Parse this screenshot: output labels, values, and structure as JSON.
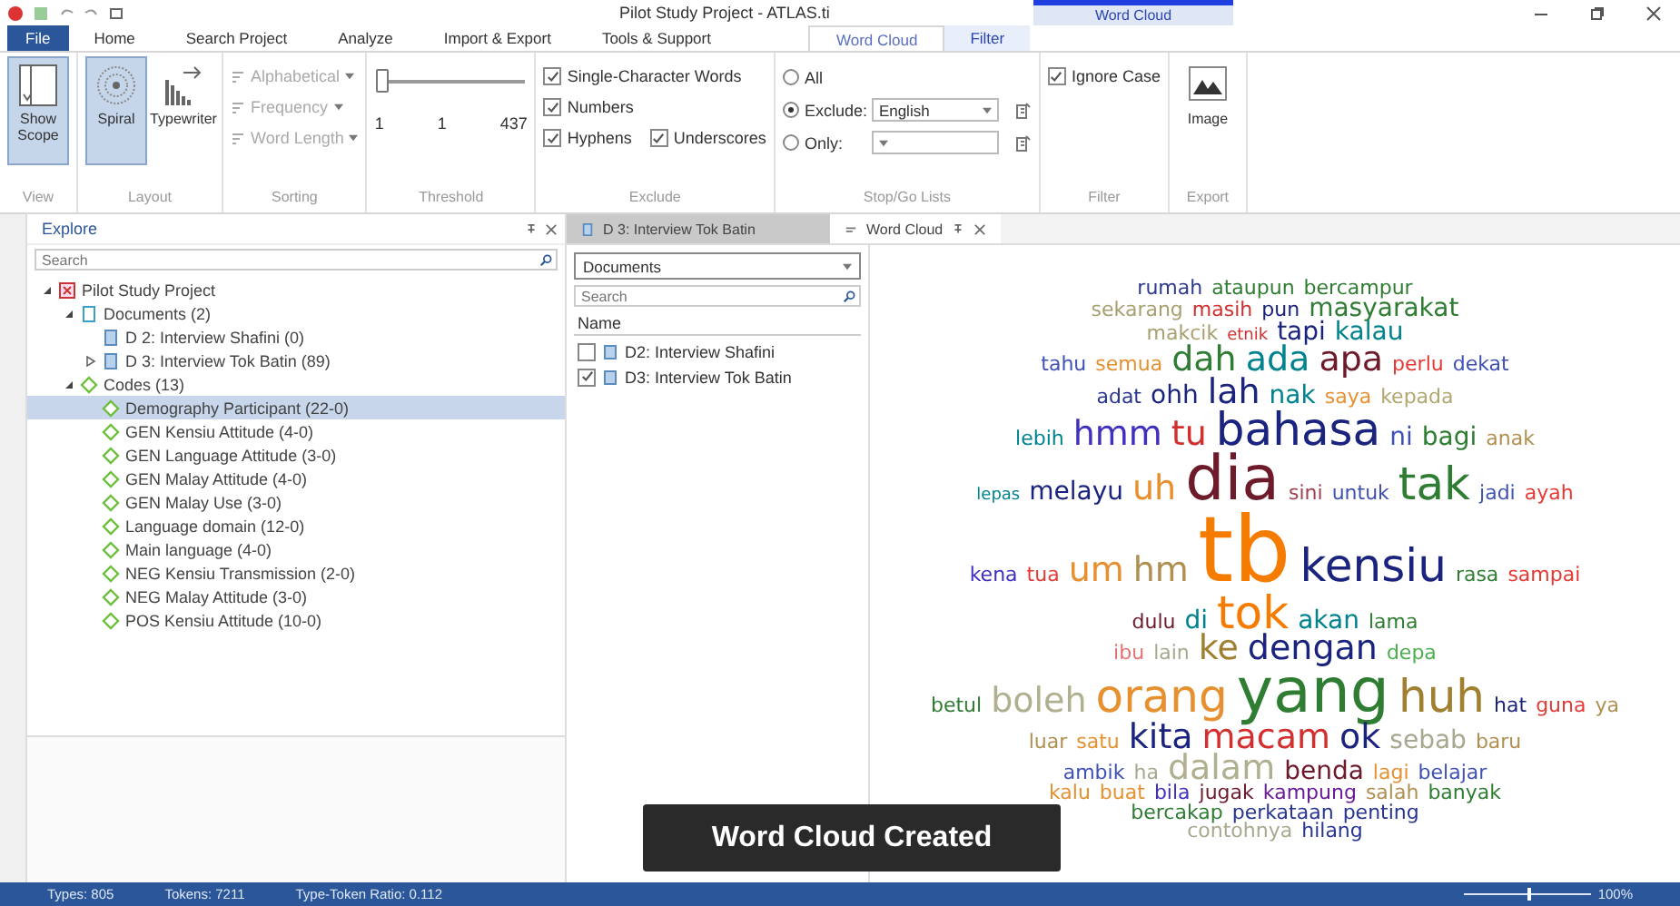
{
  "window": {
    "title": "Pilot Study Project - ATLAS.ti",
    "context_group": "Word Cloud"
  },
  "ribbon_tabs": [
    {
      "label": "File",
      "kind": "file",
      "selected": false
    },
    {
      "label": "Home",
      "kind": "normal",
      "selected": false
    },
    {
      "label": "Search Project",
      "kind": "normal",
      "selected": false
    },
    {
      "label": "Analyze",
      "kind": "normal",
      "selected": false
    },
    {
      "label": "Import & Export",
      "kind": "normal",
      "selected": false
    },
    {
      "label": "Tools & Support",
      "kind": "normal",
      "selected": false
    },
    {
      "label": "Word Cloud",
      "kind": "context",
      "selected": true
    },
    {
      "label": "Filter",
      "kind": "context",
      "selected": false
    }
  ],
  "ribbon_groups": [
    {
      "kind": "big_buttons",
      "label": "View",
      "buttons": [
        {
          "label": "Show Scope",
          "kind": "scope",
          "selected": true
        }
      ]
    },
    {
      "kind": "big_buttons",
      "label": "Layout",
      "buttons": [
        {
          "label": "Spiral",
          "kind": "spiral",
          "selected": true
        },
        {
          "label": "Typewriter",
          "kind": "typewriter",
          "selected": false
        }
      ]
    },
    {
      "kind": "menu_list",
      "label": "Sorting",
      "items": [
        {
          "label": "Alphabetical",
          "disabled": true
        },
        {
          "label": "Frequency",
          "disabled": true
        },
        {
          "label": "Word Length",
          "disabled": true
        }
      ]
    },
    {
      "kind": "slider",
      "label": "Threshold",
      "level": 0,
      "readings": [
        "1",
        "1",
        "437"
      ]
    },
    {
      "kind": "checks",
      "label": "Exclude",
      "rows": [
        {
          "items": [
            {
              "label": "Single-Character Words",
              "checked": true
            }
          ]
        },
        {
          "items": [
            {
              "label": "Numbers",
              "checked": true
            }
          ]
        },
        {
          "items": [
            {
              "label": "Hyphens",
              "checked": true
            },
            {
              "label": "Underscores",
              "checked": true
            }
          ]
        }
      ]
    },
    {
      "kind": "stop_go",
      "label": "Stop/Go Lists",
      "options": [
        {
          "label": "All",
          "kind": "plain",
          "selected": false
        },
        {
          "label": "Exclude:",
          "kind": "list",
          "value": "English",
          "selected": true
        },
        {
          "label": "Only:",
          "kind": "list",
          "selected": false
        }
      ]
    },
    {
      "kind": "checks",
      "label": "Filter",
      "rows": [
        {
          "items": [
            {
              "label": "Ignore Case",
              "checked": true
            }
          ]
        }
      ]
    },
    {
      "kind": "big_buttons",
      "label": "Export",
      "buttons": [
        {
          "label": "Image",
          "kind": "image",
          "selected": false
        }
      ]
    }
  ],
  "explore": {
    "title": "Explore",
    "search_placeholder": "Search",
    "tree": [
      {
        "label": "Pilot Study Project",
        "kind": "project",
        "expanded": true,
        "selected": false,
        "children": [
          {
            "label": "Documents (2)",
            "kind": "folder",
            "expanded": true,
            "selected": false,
            "children": [
              {
                "label": "D 2: Interview Shafini (0)",
                "kind": "document",
                "selected": false
              },
              {
                "label": "D 3: Interview Tok Batin (89)",
                "kind": "document",
                "expanded": false,
                "selected": false
              }
            ]
          },
          {
            "label": "Codes (13)",
            "kind": "codes",
            "expanded": true,
            "selected": false,
            "children": [
              {
                "label": "Demography Participant (22-0)",
                "kind": "code",
                "selected": true
              },
              {
                "label": "GEN Kensiu Attitude (4-0)",
                "kind": "code",
                "selected": false
              },
              {
                "label": "GEN Language Attitude (3-0)",
                "kind": "code",
                "selected": false
              },
              {
                "label": "GEN Malay Attitude (4-0)",
                "kind": "code",
                "selected": false
              },
              {
                "label": "GEN Malay Use (3-0)",
                "kind": "code",
                "selected": false
              },
              {
                "label": "Language domain (12-0)",
                "kind": "code",
                "selected": false
              },
              {
                "label": "Main language (4-0)",
                "kind": "code",
                "selected": false
              },
              {
                "label": "NEG Kensiu Transmission (2-0)",
                "kind": "code",
                "selected": false
              },
              {
                "label": "NEG Malay Attitude (3-0)",
                "kind": "code",
                "selected": false
              },
              {
                "label": "POS Kensiu Attitude (10-0)",
                "kind": "code",
                "selected": false
              }
            ]
          }
        ]
      }
    ]
  },
  "doc_tabs": [
    {
      "label": "D 3: Interview Tok Batin",
      "kind": "document",
      "selected": false
    },
    {
      "label": "Word Cloud",
      "kind": "wordcloud",
      "selected": true
    }
  ],
  "scope": {
    "dropdown": "Documents",
    "search_placeholder": "Search",
    "column": "Name",
    "rows": [
      {
        "label": "D2: Interview Shafini",
        "checked": false
      },
      {
        "label": "D3: Interview Tok Batin",
        "checked": true
      }
    ]
  },
  "word_cloud": {
    "lines": [
      {
        "words": [
          {
            "text": "rumah",
            "kind": "small",
            "color": "#2e3a8c"
          },
          {
            "text": "ataupun",
            "kind": "small",
            "color": "#2e7d32"
          },
          {
            "text": "bercampur",
            "kind": "small",
            "color": "#2e7d32"
          }
        ]
      },
      {
        "words": [
          {
            "text": "sekarang",
            "kind": "small",
            "color": "#a8a070"
          },
          {
            "text": "masih",
            "kind": "small",
            "color": "#d32f2f"
          },
          {
            "text": "pun",
            "kind": "small",
            "color": "#1a237e"
          },
          {
            "text": "masyarakat",
            "kind": "medium",
            "color": "#2e7d32"
          }
        ]
      },
      {
        "words": [
          {
            "text": "makcik",
            "kind": "small",
            "color": "#a8a070"
          },
          {
            "text": "etnik",
            "kind": "tiny",
            "color": "#d32f2f"
          },
          {
            "text": "tapi",
            "kind": "medium",
            "color": "#1a237e"
          },
          {
            "text": "kalau",
            "kind": "medium",
            "color": "#00838f"
          }
        ]
      },
      {
        "words": [
          {
            "text": "tahu",
            "kind": "small",
            "color": "#3f51b5"
          },
          {
            "text": "semua",
            "kind": "small",
            "color": "#e69030"
          },
          {
            "text": "dah",
            "kind": "large",
            "color": "#2e7d32"
          },
          {
            "text": "ada",
            "kind": "large",
            "color": "#00838f"
          },
          {
            "text": "apa",
            "kind": "large",
            "color": "#6d1b2b"
          },
          {
            "text": "perlu",
            "kind": "small",
            "color": "#e53935"
          },
          {
            "text": "dekat",
            "kind": "small",
            "color": "#3f51b5"
          }
        ]
      },
      {
        "words": [
          {
            "text": "adat",
            "kind": "small",
            "color": "#283593"
          },
          {
            "text": "ohh",
            "kind": "medium",
            "color": "#1a237e"
          },
          {
            "text": "lah",
            "kind": "large",
            "color": "#1a237e"
          },
          {
            "text": "nak",
            "kind": "medium",
            "color": "#00838f"
          },
          {
            "text": "saya",
            "kind": "small",
            "color": "#e69030"
          },
          {
            "text": "kepada",
            "kind": "small",
            "color": "#b0a870"
          }
        ]
      },
      {
        "words": [
          {
            "text": "lebih",
            "kind": "small",
            "color": "#00838f"
          },
          {
            "text": "hmm",
            "kind": "large",
            "color": "#3f30c0"
          },
          {
            "text": "tu",
            "kind": "large",
            "color": "#d32f2f"
          },
          {
            "text": "bahasa",
            "kind": "big",
            "color": "#1a237e"
          },
          {
            "text": "ni",
            "kind": "medium",
            "color": "#3f51b5"
          },
          {
            "text": "bagi",
            "kind": "medium",
            "color": "#2e7d32"
          },
          {
            "text": "anak",
            "kind": "small",
            "color": "#b09050"
          }
        ]
      },
      {
        "words": [
          {
            "text": "lepas",
            "kind": "tiny",
            "color": "#00838f"
          },
          {
            "text": "melayu",
            "kind": "medium",
            "color": "#1a237e"
          },
          {
            "text": "uh",
            "kind": "large",
            "color": "#e69030"
          },
          {
            "text": "dia",
            "kind": "huge",
            "color": "#6d1b2b"
          },
          {
            "text": "sini",
            "kind": "small",
            "color": "#a04050"
          },
          {
            "text": "untuk",
            "kind": "small",
            "color": "#3f51b5"
          },
          {
            "text": "tak",
            "kind": "big",
            "color": "#2e7d32"
          },
          {
            "text": "jadi",
            "kind": "small",
            "color": "#3f51b5"
          },
          {
            "text": "ayah",
            "kind": "small",
            "color": "#e53935"
          }
        ]
      },
      {
        "words": [
          {
            "text": "kena",
            "kind": "small",
            "color": "#3f30c0"
          },
          {
            "text": "tua",
            "kind": "small",
            "color": "#e53935"
          },
          {
            "text": "um",
            "kind": "large",
            "color": "#e69030"
          },
          {
            "text": "hm",
            "kind": "large",
            "color": "#b09050"
          },
          {
            "text": "tb",
            "kind": "giant",
            "color": "#f57c00"
          },
          {
            "text": "kensiu",
            "kind": "big",
            "color": "#1a237e"
          },
          {
            "text": "rasa",
            "kind": "small",
            "color": "#2e7d32"
          },
          {
            "text": "sampai",
            "kind": "small",
            "color": "#e53935"
          }
        ]
      },
      {
        "words": [
          {
            "text": "dulu",
            "kind": "small",
            "color": "#6d1b2b"
          },
          {
            "text": "di",
            "kind": "medium",
            "color": "#00838f"
          },
          {
            "text": "tok",
            "kind": "big",
            "color": "#f57c00"
          },
          {
            "text": "akan",
            "kind": "medium",
            "color": "#00838f"
          },
          {
            "text": "lama",
            "kind": "small",
            "color": "#2e7d32"
          }
        ]
      },
      {
        "words": [
          {
            "text": "ibu",
            "kind": "small",
            "color": "#e57373"
          },
          {
            "text": "lain",
            "kind": "small",
            "color": "#a8a890"
          },
          {
            "text": "ke",
            "kind": "large",
            "color": "#a08030"
          },
          {
            "text": "dengan",
            "kind": "large",
            "color": "#1a237e"
          },
          {
            "text": "depa",
            "kind": "small",
            "color": "#4caf50"
          }
        ]
      },
      {
        "words": [
          {
            "text": "betul",
            "kind": "small",
            "color": "#2e7d32"
          },
          {
            "text": "boleh",
            "kind": "large",
            "color": "#b0b090"
          },
          {
            "text": "orang",
            "kind": "big",
            "color": "#e69030"
          },
          {
            "text": "yang",
            "kind": "huge",
            "color": "#2e7d32"
          },
          {
            "text": "huh",
            "kind": "big",
            "color": "#a08030"
          },
          {
            "text": "hat",
            "kind": "small",
            "color": "#1a237e"
          },
          {
            "text": "guna",
            "kind": "small",
            "color": "#e53935"
          },
          {
            "text": "ya",
            "kind": "small",
            "color": "#b09050"
          }
        ]
      },
      {
        "words": [
          {
            "text": "luar",
            "kind": "small",
            "color": "#b09050"
          },
          {
            "text": "satu",
            "kind": "small",
            "color": "#e69030"
          },
          {
            "text": "kita",
            "kind": "large",
            "color": "#1a237e"
          },
          {
            "text": "macam",
            "kind": "large",
            "color": "#d32f2f"
          },
          {
            "text": "ok",
            "kind": "large",
            "color": "#1a237e"
          },
          {
            "text": "sebab",
            "kind": "medium",
            "color": "#a8a890"
          },
          {
            "text": "baru",
            "kind": "small",
            "color": "#b09050"
          }
        ]
      },
      {
        "words": [
          {
            "text": "ambik",
            "kind": "small",
            "color": "#3f51b5"
          },
          {
            "text": "ha",
            "kind": "small",
            "color": "#a8a890"
          },
          {
            "text": "dalam",
            "kind": "large",
            "color": "#b0b090"
          },
          {
            "text": "benda",
            "kind": "medium",
            "color": "#6d1b2b"
          },
          {
            "text": "lagi",
            "kind": "small",
            "color": "#e69030"
          },
          {
            "text": "belajar",
            "kind": "small",
            "color": "#3f51b5"
          }
        ]
      },
      {
        "words": [
          {
            "text": "kalu",
            "kind": "small",
            "color": "#e69030"
          },
          {
            "text": "buat",
            "kind": "small",
            "color": "#e69030"
          },
          {
            "text": "bila",
            "kind": "small",
            "color": "#3f30c0"
          },
          {
            "text": "jugak",
            "kind": "small",
            "color": "#6d1b2b"
          },
          {
            "text": "kampung",
            "kind": "small",
            "color": "#6a1b9a"
          },
          {
            "text": "salah",
            "kind": "small",
            "color": "#b09050"
          },
          {
            "text": "banyak",
            "kind": "small",
            "color": "#2e7d32"
          }
        ]
      },
      {
        "words": [
          {
            "text": "bercakap",
            "kind": "small",
            "color": "#2e7d32"
          },
          {
            "text": "perkataan",
            "kind": "small",
            "color": "#283593"
          },
          {
            "text": "penting",
            "kind": "small",
            "color": "#283593"
          }
        ]
      },
      {
        "words": [
          {
            "text": "contohnya",
            "kind": "small",
            "color": "#a8a890"
          },
          {
            "text": "hilang",
            "kind": "small",
            "color": "#283593"
          }
        ]
      }
    ]
  },
  "toast": "Word Cloud Created",
  "status_bar": {
    "items": [
      "Types: 805",
      "Tokens: 7211",
      "Type-Token Ratio: 0.112"
    ],
    "zoom": {
      "level": 0.5,
      "reading": "100%"
    }
  }
}
